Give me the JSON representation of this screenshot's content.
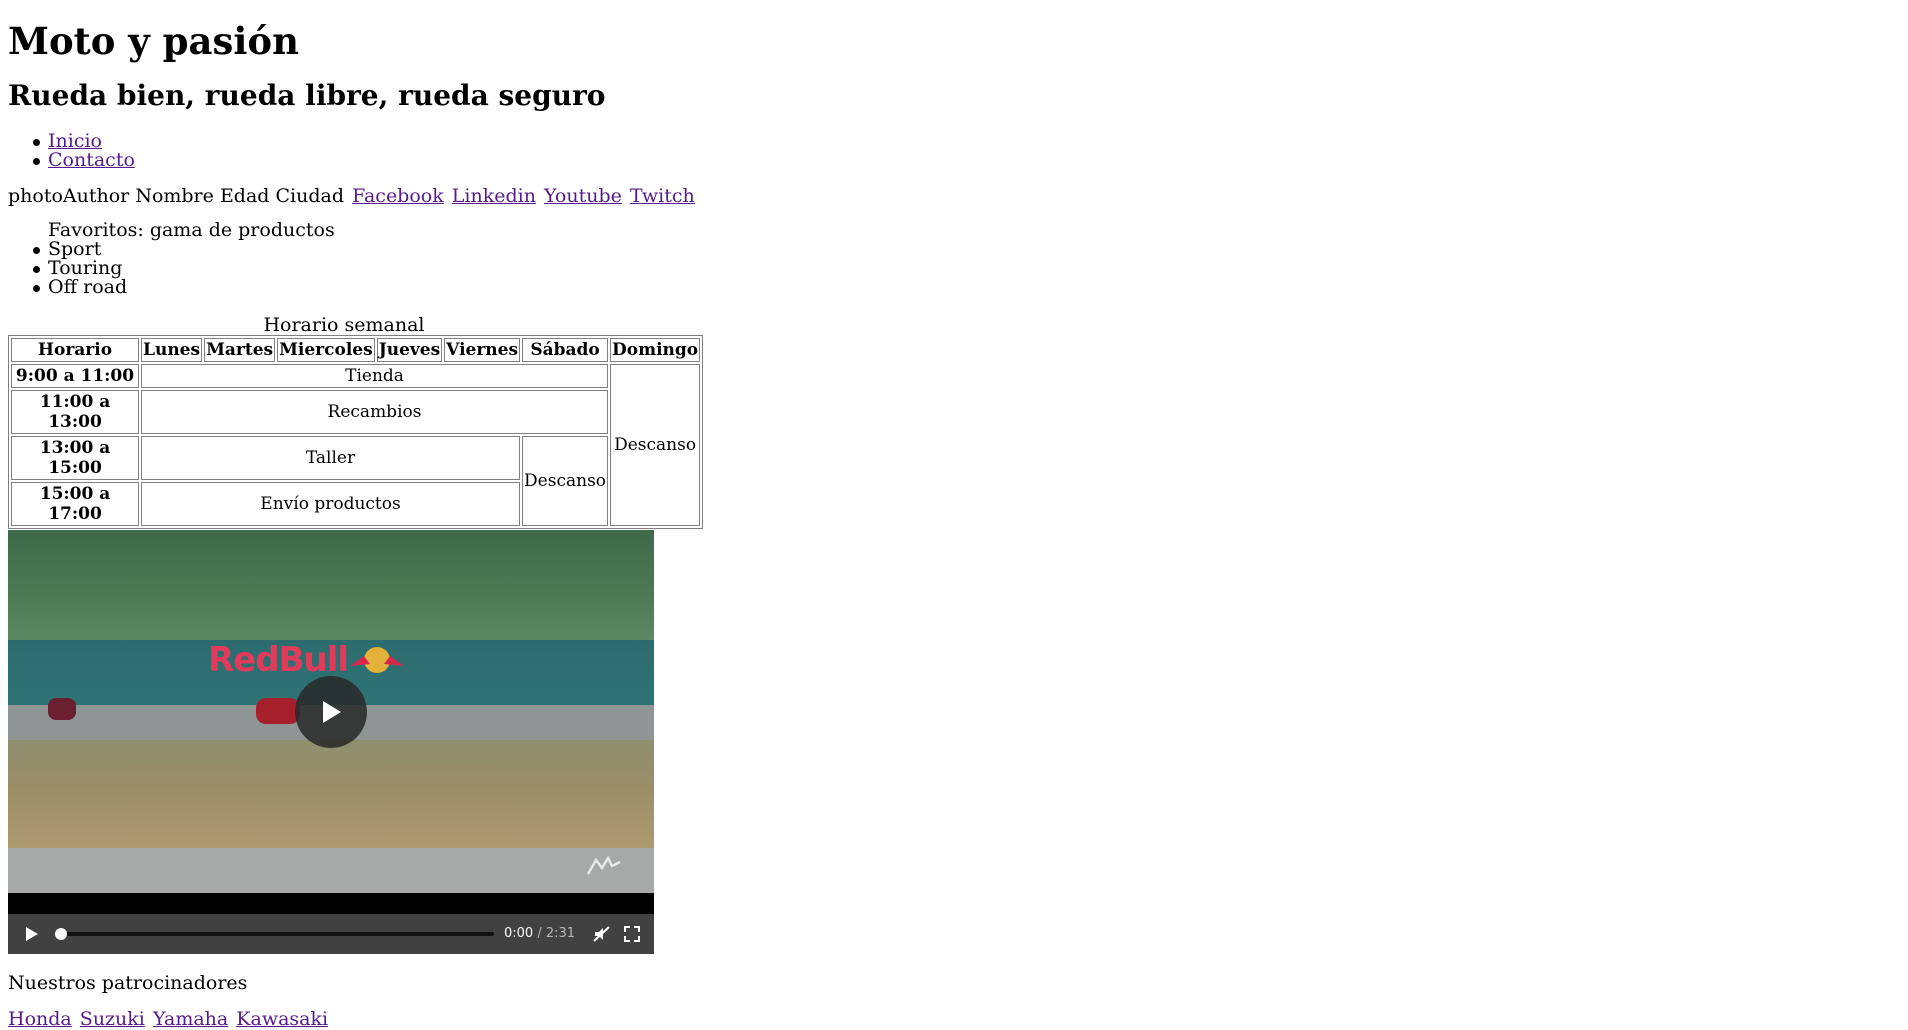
{
  "header": {
    "title": "Moto y pasión",
    "subtitle": "Rueda bien, rueda libre, rueda seguro"
  },
  "nav": {
    "items": [
      {
        "label": "Inicio"
      },
      {
        "label": "Contacto"
      }
    ]
  },
  "author": {
    "photo_alt": "photoAuthor",
    "name": "Nombre",
    "age": "Edad",
    "city": "Ciudad",
    "social": [
      {
        "label": "Facebook"
      },
      {
        "label": "Linkedin"
      },
      {
        "label": "Youtube"
      },
      {
        "label": "Twitch"
      }
    ]
  },
  "favorites": {
    "heading": "Favoritos: gama de productos",
    "items": [
      "Sport",
      "Touring",
      "Off road"
    ]
  },
  "schedule": {
    "caption": "Horario semanal",
    "headers": [
      "Horario",
      "Lunes",
      "Martes",
      "Miercoles",
      "Jueves",
      "Viernes",
      "Sábado",
      "Domingo"
    ],
    "rows": [
      {
        "time": "9:00 a 11:00",
        "activity": "Tienda"
      },
      {
        "time": "11:00 a 13:00",
        "activity": "Recambios"
      },
      {
        "time": "13:00 a 15:00",
        "activity": "Taller"
      },
      {
        "time": "15:00 a 17:00",
        "activity": "Envío productos"
      }
    ],
    "saturday_rest": "Descanso",
    "sunday_rest": "Descanso"
  },
  "video": {
    "current_time": "0:00",
    "separator": " / ",
    "duration": "2:31",
    "progress": 0,
    "banner_text": "RedBull"
  },
  "sponsors": {
    "title": "Nuestros patrocinadores",
    "links": [
      {
        "label": "Honda"
      },
      {
        "label": "Suzuki"
      },
      {
        "label": "Yamaha"
      },
      {
        "label": "Kawasaki"
      }
    ]
  },
  "colors": {
    "link": "#551a8b",
    "controls_bg": "#414141"
  }
}
